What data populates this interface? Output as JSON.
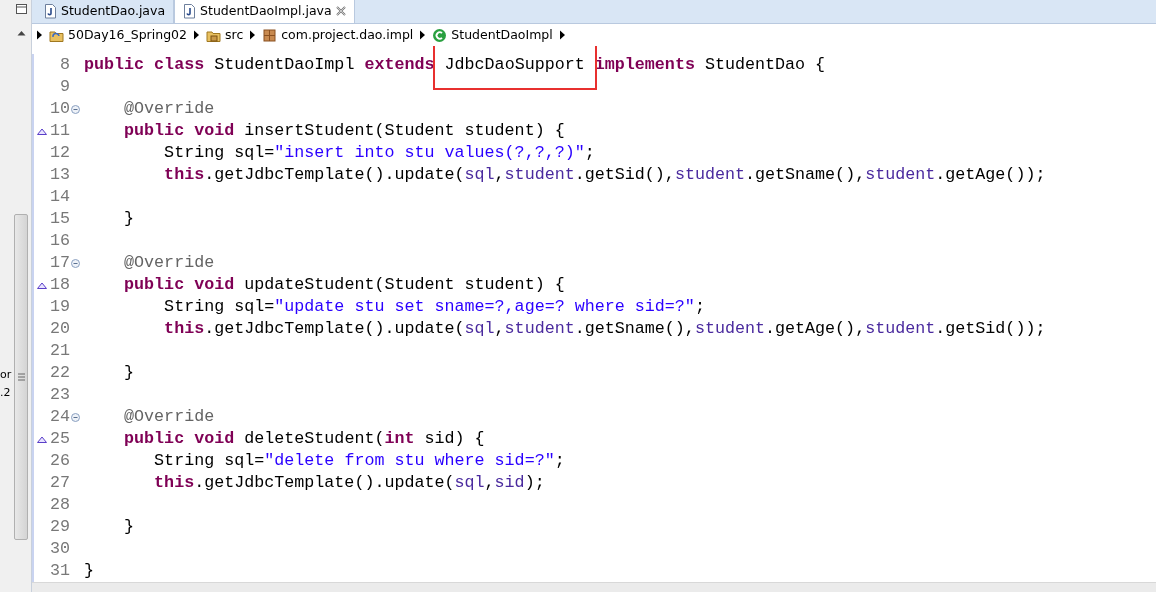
{
  "side_panel": {
    "fragments": [
      "or",
      ".2"
    ]
  },
  "tabs": [
    {
      "label": "StudentDao.java",
      "selected": false,
      "closable": false
    },
    {
      "label": "StudentDaoImpl.java",
      "selected": true,
      "closable": true
    }
  ],
  "breadcrumb": [
    {
      "label": "50Day16_Spring02",
      "kind": "project"
    },
    {
      "label": "src",
      "kind": "source-folder"
    },
    {
      "label": "com.project.dao.impl",
      "kind": "package"
    },
    {
      "label": "StudentDaoImpl",
      "kind": "class"
    }
  ],
  "editor": {
    "lines": [
      {
        "number": "8",
        "fold": false,
        "override": false,
        "tokens": [
          {
            "kind": "keyword",
            "text": "public "
          },
          {
            "kind": "keyword",
            "text": "class "
          },
          {
            "kind": "plain",
            "text": "StudentDaoImpl "
          },
          {
            "kind": "keyword",
            "text": "extends "
          },
          {
            "kind": "plain",
            "text": "JdbcDaoSupport",
            "highlighted": true
          },
          {
            "kind": "keyword",
            "text": " implements"
          },
          {
            "kind": "plain",
            "text": " StudentDao {"
          }
        ]
      },
      {
        "number": "9",
        "fold": false,
        "override": false
      },
      {
        "number": "10",
        "fold": true,
        "override": false,
        "tokens": [
          {
            "kind": "annotation",
            "text": "    @Override"
          }
        ]
      },
      {
        "number": "11",
        "fold": false,
        "override": true,
        "tokens": [
          {
            "kind": "keyword",
            "text": "    public "
          },
          {
            "kind": "keyword",
            "text": "void "
          },
          {
            "kind": "plain",
            "text": "insertStudent(Student student) {"
          }
        ]
      },
      {
        "number": "12",
        "fold": false,
        "override": false,
        "tokens": [
          {
            "kind": "plain",
            "text": "        String sql="
          },
          {
            "kind": "string",
            "text": "\"insert into stu values(?,?,?)\""
          },
          {
            "kind": "plain",
            "text": ";"
          }
        ]
      },
      {
        "number": "13",
        "fold": false,
        "override": false,
        "tokens": [
          {
            "kind": "keyword",
            "text": "        this"
          },
          {
            "kind": "plain",
            "text": ".getJdbcTemplate().update("
          },
          {
            "kind": "variable",
            "text": "sql"
          },
          {
            "kind": "plain",
            "text": ","
          },
          {
            "kind": "variable",
            "text": "student"
          },
          {
            "kind": "plain",
            "text": ".getSid(),"
          },
          {
            "kind": "variable",
            "text": "student"
          },
          {
            "kind": "plain",
            "text": ".getSname(),"
          },
          {
            "kind": "variable",
            "text": "student"
          },
          {
            "kind": "plain",
            "text": ".getAge());"
          }
        ]
      },
      {
        "number": "14",
        "fold": false,
        "override": false
      },
      {
        "number": "15",
        "fold": false,
        "override": false,
        "tokens": [
          {
            "kind": "plain",
            "text": "    }"
          }
        ]
      },
      {
        "number": "16",
        "fold": false,
        "override": false
      },
      {
        "number": "17",
        "fold": true,
        "override": false,
        "tokens": [
          {
            "kind": "annotation",
            "text": "    @Override"
          }
        ]
      },
      {
        "number": "18",
        "fold": false,
        "override": true,
        "tokens": [
          {
            "kind": "keyword",
            "text": "    public "
          },
          {
            "kind": "keyword",
            "text": "void "
          },
          {
            "kind": "plain",
            "text": "updateStudent(Student student) {"
          }
        ]
      },
      {
        "number": "19",
        "fold": false,
        "override": false,
        "tokens": [
          {
            "kind": "plain",
            "text": "        String sql="
          },
          {
            "kind": "string",
            "text": "\"update stu set sname=?,age=? where sid=?\""
          },
          {
            "kind": "plain",
            "text": ";"
          }
        ]
      },
      {
        "number": "20",
        "fold": false,
        "override": false,
        "tokens": [
          {
            "kind": "keyword",
            "text": "        this"
          },
          {
            "kind": "plain",
            "text": ".getJdbcTemplate().update("
          },
          {
            "kind": "variable",
            "text": "sql"
          },
          {
            "kind": "plain",
            "text": ","
          },
          {
            "kind": "variable",
            "text": "student"
          },
          {
            "kind": "plain",
            "text": ".getSname(),"
          },
          {
            "kind": "variable",
            "text": "student"
          },
          {
            "kind": "plain",
            "text": ".getAge(),"
          },
          {
            "kind": "variable",
            "text": "student"
          },
          {
            "kind": "plain",
            "text": ".getSid());"
          }
        ]
      },
      {
        "number": "21",
        "fold": false,
        "override": false
      },
      {
        "number": "22",
        "fold": false,
        "override": false,
        "tokens": [
          {
            "kind": "plain",
            "text": "    }"
          }
        ]
      },
      {
        "number": "23",
        "fold": false,
        "override": false
      },
      {
        "number": "24",
        "fold": true,
        "override": false,
        "tokens": [
          {
            "kind": "annotation",
            "text": "    @Override"
          }
        ]
      },
      {
        "number": "25",
        "fold": false,
        "override": true,
        "tokens": [
          {
            "kind": "keyword",
            "text": "    public "
          },
          {
            "kind": "keyword",
            "text": "void "
          },
          {
            "kind": "plain",
            "text": "deleteStudent("
          },
          {
            "kind": "keyword",
            "text": "int"
          },
          {
            "kind": "plain",
            "text": " sid) {"
          }
        ]
      },
      {
        "number": "26",
        "fold": false,
        "override": false,
        "tokens": [
          {
            "kind": "plain",
            "text": "       String sql="
          },
          {
            "kind": "string",
            "text": "\"delete from stu where sid=?\""
          },
          {
            "kind": "plain",
            "text": ";"
          }
        ]
      },
      {
        "number": "27",
        "fold": false,
        "override": false,
        "tokens": [
          {
            "kind": "keyword",
            "text": "       this"
          },
          {
            "kind": "plain",
            "text": ".getJdbcTemplate().update("
          },
          {
            "kind": "variable",
            "text": "sql"
          },
          {
            "kind": "plain",
            "text": ","
          },
          {
            "kind": "variable",
            "text": "sid"
          },
          {
            "kind": "plain",
            "text": ");"
          }
        ]
      },
      {
        "number": "28",
        "fold": false,
        "override": false
      },
      {
        "number": "29",
        "fold": false,
        "override": false,
        "tokens": [
          {
            "kind": "plain",
            "text": "    }"
          }
        ]
      },
      {
        "number": "30",
        "fold": false,
        "override": false
      },
      {
        "number": "31",
        "fold": false,
        "override": false,
        "tokens": [
          {
            "kind": "plain",
            "text": "}"
          }
        ]
      }
    ]
  }
}
